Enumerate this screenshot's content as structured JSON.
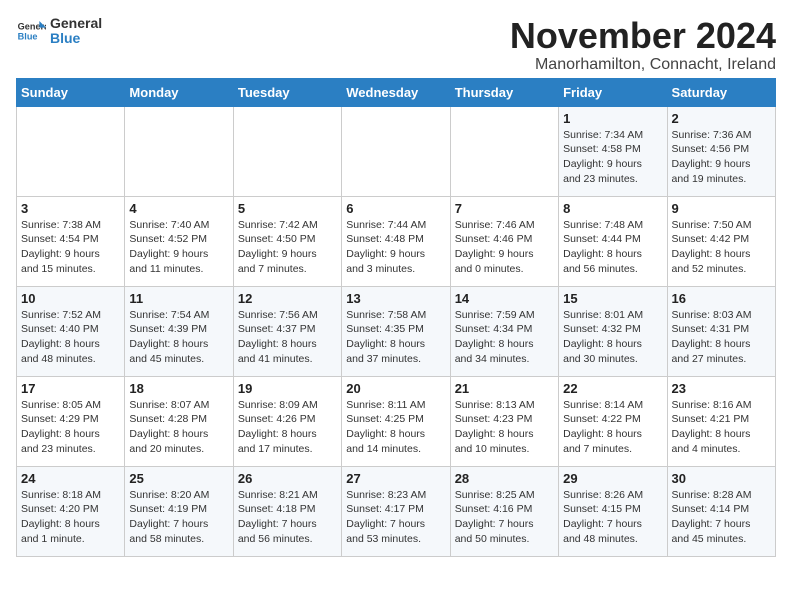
{
  "header": {
    "logo_general": "General",
    "logo_blue": "Blue",
    "title": "November 2024",
    "subtitle": "Manorhamilton, Connacht, Ireland"
  },
  "weekdays": [
    "Sunday",
    "Monday",
    "Tuesday",
    "Wednesday",
    "Thursday",
    "Friday",
    "Saturday"
  ],
  "weeks": [
    [
      {
        "day": "",
        "info": ""
      },
      {
        "day": "",
        "info": ""
      },
      {
        "day": "",
        "info": ""
      },
      {
        "day": "",
        "info": ""
      },
      {
        "day": "",
        "info": ""
      },
      {
        "day": "1",
        "info": "Sunrise: 7:34 AM\nSunset: 4:58 PM\nDaylight: 9 hours\nand 23 minutes."
      },
      {
        "day": "2",
        "info": "Sunrise: 7:36 AM\nSunset: 4:56 PM\nDaylight: 9 hours\nand 19 minutes."
      }
    ],
    [
      {
        "day": "3",
        "info": "Sunrise: 7:38 AM\nSunset: 4:54 PM\nDaylight: 9 hours\nand 15 minutes."
      },
      {
        "day": "4",
        "info": "Sunrise: 7:40 AM\nSunset: 4:52 PM\nDaylight: 9 hours\nand 11 minutes."
      },
      {
        "day": "5",
        "info": "Sunrise: 7:42 AM\nSunset: 4:50 PM\nDaylight: 9 hours\nand 7 minutes."
      },
      {
        "day": "6",
        "info": "Sunrise: 7:44 AM\nSunset: 4:48 PM\nDaylight: 9 hours\nand 3 minutes."
      },
      {
        "day": "7",
        "info": "Sunrise: 7:46 AM\nSunset: 4:46 PM\nDaylight: 9 hours\nand 0 minutes."
      },
      {
        "day": "8",
        "info": "Sunrise: 7:48 AM\nSunset: 4:44 PM\nDaylight: 8 hours\nand 56 minutes."
      },
      {
        "day": "9",
        "info": "Sunrise: 7:50 AM\nSunset: 4:42 PM\nDaylight: 8 hours\nand 52 minutes."
      }
    ],
    [
      {
        "day": "10",
        "info": "Sunrise: 7:52 AM\nSunset: 4:40 PM\nDaylight: 8 hours\nand 48 minutes."
      },
      {
        "day": "11",
        "info": "Sunrise: 7:54 AM\nSunset: 4:39 PM\nDaylight: 8 hours\nand 45 minutes."
      },
      {
        "day": "12",
        "info": "Sunrise: 7:56 AM\nSunset: 4:37 PM\nDaylight: 8 hours\nand 41 minutes."
      },
      {
        "day": "13",
        "info": "Sunrise: 7:58 AM\nSunset: 4:35 PM\nDaylight: 8 hours\nand 37 minutes."
      },
      {
        "day": "14",
        "info": "Sunrise: 7:59 AM\nSunset: 4:34 PM\nDaylight: 8 hours\nand 34 minutes."
      },
      {
        "day": "15",
        "info": "Sunrise: 8:01 AM\nSunset: 4:32 PM\nDaylight: 8 hours\nand 30 minutes."
      },
      {
        "day": "16",
        "info": "Sunrise: 8:03 AM\nSunset: 4:31 PM\nDaylight: 8 hours\nand 27 minutes."
      }
    ],
    [
      {
        "day": "17",
        "info": "Sunrise: 8:05 AM\nSunset: 4:29 PM\nDaylight: 8 hours\nand 23 minutes."
      },
      {
        "day": "18",
        "info": "Sunrise: 8:07 AM\nSunset: 4:28 PM\nDaylight: 8 hours\nand 20 minutes."
      },
      {
        "day": "19",
        "info": "Sunrise: 8:09 AM\nSunset: 4:26 PM\nDaylight: 8 hours\nand 17 minutes."
      },
      {
        "day": "20",
        "info": "Sunrise: 8:11 AM\nSunset: 4:25 PM\nDaylight: 8 hours\nand 14 minutes."
      },
      {
        "day": "21",
        "info": "Sunrise: 8:13 AM\nSunset: 4:23 PM\nDaylight: 8 hours\nand 10 minutes."
      },
      {
        "day": "22",
        "info": "Sunrise: 8:14 AM\nSunset: 4:22 PM\nDaylight: 8 hours\nand 7 minutes."
      },
      {
        "day": "23",
        "info": "Sunrise: 8:16 AM\nSunset: 4:21 PM\nDaylight: 8 hours\nand 4 minutes."
      }
    ],
    [
      {
        "day": "24",
        "info": "Sunrise: 8:18 AM\nSunset: 4:20 PM\nDaylight: 8 hours\nand 1 minute."
      },
      {
        "day": "25",
        "info": "Sunrise: 8:20 AM\nSunset: 4:19 PM\nDaylight: 7 hours\nand 58 minutes."
      },
      {
        "day": "26",
        "info": "Sunrise: 8:21 AM\nSunset: 4:18 PM\nDaylight: 7 hours\nand 56 minutes."
      },
      {
        "day": "27",
        "info": "Sunrise: 8:23 AM\nSunset: 4:17 PM\nDaylight: 7 hours\nand 53 minutes."
      },
      {
        "day": "28",
        "info": "Sunrise: 8:25 AM\nSunset: 4:16 PM\nDaylight: 7 hours\nand 50 minutes."
      },
      {
        "day": "29",
        "info": "Sunrise: 8:26 AM\nSunset: 4:15 PM\nDaylight: 7 hours\nand 48 minutes."
      },
      {
        "day": "30",
        "info": "Sunrise: 8:28 AM\nSunset: 4:14 PM\nDaylight: 7 hours\nand 45 minutes."
      }
    ]
  ]
}
